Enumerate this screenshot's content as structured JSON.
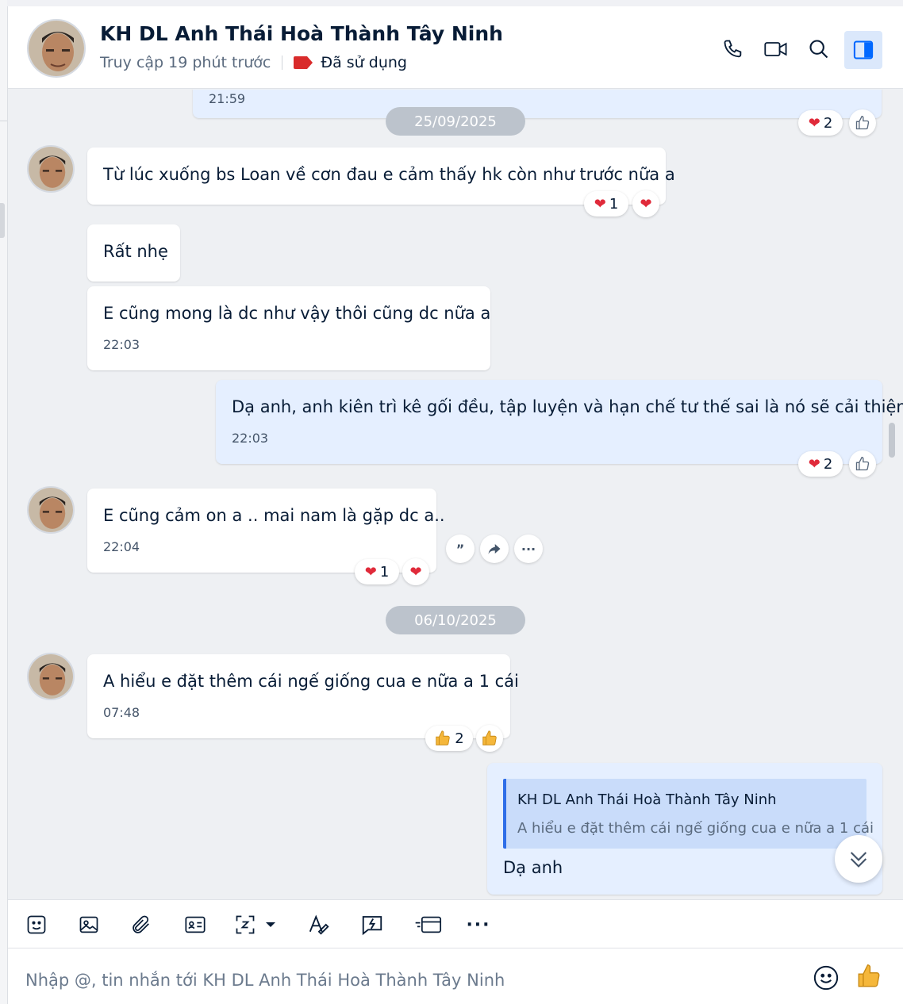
{
  "header": {
    "contact_name": "KH DL Anh Thái Hoà Thành Tây Ninh",
    "last_seen": "Truy cập 19 phút trước",
    "tag_label": "Đã sử dụng",
    "tag_color": "#d92b2b",
    "actions": [
      "phone-icon",
      "video-call-icon",
      "search-icon",
      "sidebar-toggle-icon"
    ]
  },
  "messages": {
    "prev_time": "21:59",
    "prev_reaction_count": "2",
    "date1": "25/09/2025",
    "m1_text": "Từ lúc xuống bs Loan về cơn đau e cảm thấy hk còn như trước nữa a",
    "m1_reaction_count": "1",
    "m2_text": "Rất nhẹ",
    "m3_text": "E cũng mong là dc như vậy thôi cũng dc nữa a",
    "m3_time": "22:03",
    "m4_text": "Dạ anh, anh kiên trì kê gối đều, tập luyện và hạn chế tư thế sai là nó sẽ cải thiện",
    "m4_time": "22:03",
    "m4_reaction_count": "2",
    "m5_text": "E cũng cảm on a .. mai nam là gặp dc a..",
    "m5_time": "22:04",
    "m5_reaction_count": "1",
    "date2": "06/10/2025",
    "m6_text": "A hiểu e đặt thêm cái ngế giống cua e nữa a 1 cái",
    "m6_time": "07:48",
    "m6_reaction_count": "2",
    "m7_quote_name": "KH DL Anh Thái Hoà Thành Tây Ninh",
    "m7_quote_text": "A hiểu e đặt thêm cái ngế giống cua e nữa a 1 cái",
    "m7_text": "Dạ anh"
  },
  "toolbar": {
    "icons": [
      "sticker-icon",
      "image-icon",
      "attachment-icon",
      "contact-card-icon",
      "screenshot-icon",
      "text-format-icon",
      "quick-message-icon",
      "payment-card-icon",
      "more-icon"
    ]
  },
  "composer": {
    "placeholder": "Nhập @, tin nhắn tới KH DL Anh Thái Hoà Thành Tây Ninh"
  },
  "colors": {
    "accent": "#2f6ee8",
    "my_bubble": "#e5efff",
    "heart": "#e02a3a",
    "thumb": "#f5b73b"
  }
}
